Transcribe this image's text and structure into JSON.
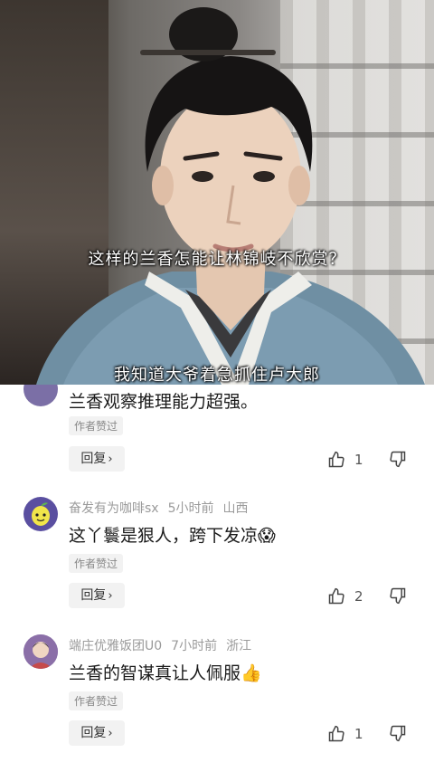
{
  "video": {
    "caption_top": "这样的兰香怎能让林锦岐不欣赏？",
    "caption_bottom": "我知道大爷着急抓住卢大郎"
  },
  "comments": [
    {
      "text": "兰香观察推理能力超强。",
      "badge": "作者赞过",
      "reply_label": "回复",
      "likes": "1"
    },
    {
      "username": "奋发有为咖啡sx",
      "time": "5小时前",
      "location": "山西",
      "text": "这丫鬟是狠人，跨下发凉😱",
      "badge": "作者赞过",
      "reply_label": "回复",
      "likes": "2"
    },
    {
      "username": "端庄优雅饭团U0",
      "time": "7小时前",
      "location": "浙江",
      "text": "兰香的智谋真让人佩服👍",
      "badge": "作者赞过",
      "reply_label": "回复",
      "likes": "1"
    }
  ]
}
